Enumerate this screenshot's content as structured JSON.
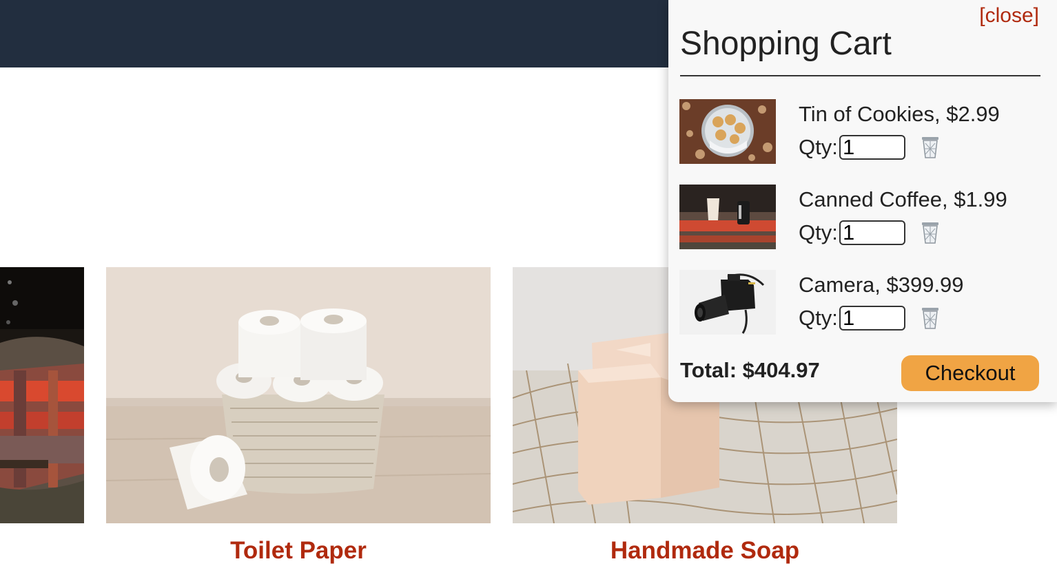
{
  "cart": {
    "close_label": "[close]",
    "title": "Shopping Cart",
    "qty_label": "Qty:",
    "items": [
      {
        "name": "Tin of Cookies, $2.99",
        "qty": "1",
        "image_icon": "cookie-tin-image"
      },
      {
        "name": "Canned Coffee, $1.99",
        "qty": "1",
        "image_icon": "canned-coffee-image"
      },
      {
        "name": "Camera, $399.99",
        "qty": "1",
        "image_icon": "camera-image"
      }
    ],
    "total": "Total: $404.97",
    "checkout_label": "Checkout"
  },
  "products": [
    {
      "name": "",
      "image_icon": "canned-coffee-image"
    },
    {
      "name": "Toilet Paper",
      "image_icon": "toilet-paper-image"
    },
    {
      "name": "Handmade Soap",
      "image_icon": "handmade-soap-image"
    }
  ],
  "colors": {
    "header": "#222e3f",
    "accent_red": "#b02a0e",
    "checkout_orange": "#f0a444",
    "cart_background": "#f8f8f8"
  }
}
